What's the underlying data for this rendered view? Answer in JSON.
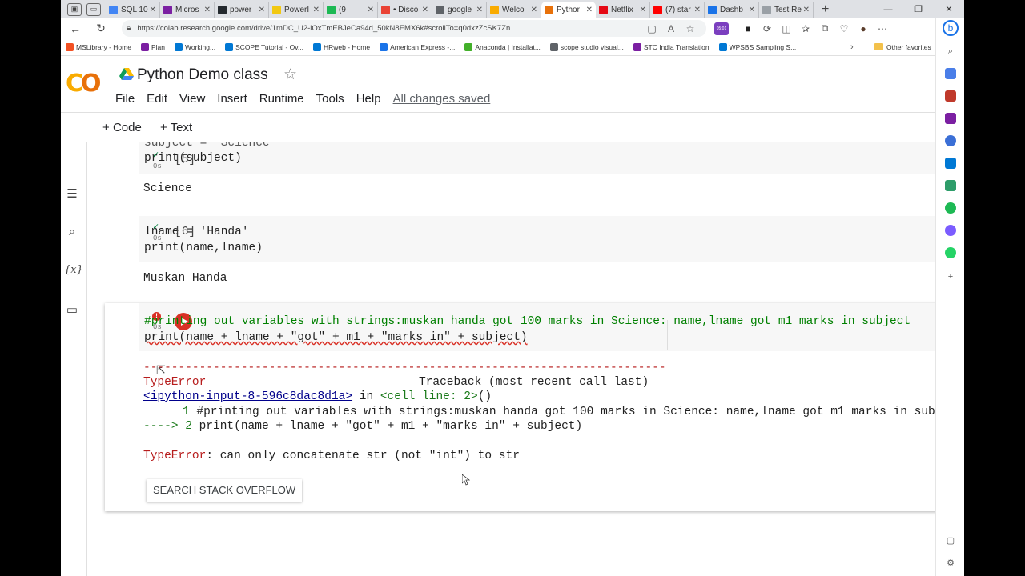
{
  "browser": {
    "tabs": [
      {
        "label": "SQL 10",
        "color": "#4285f4"
      },
      {
        "label": "Micros",
        "color": "#7b1fa2"
      },
      {
        "label": "power",
        "color": "#24292e"
      },
      {
        "label": "PowerI",
        "color": "#f2c811"
      },
      {
        "label": "(9",
        "color": "#1db954"
      },
      {
        "label": "• Disco",
        "color": "#ea4335"
      },
      {
        "label": "google",
        "color": "#5f6368"
      },
      {
        "label": "Welco",
        "color": "#f9ab00"
      },
      {
        "label": "Pythor",
        "color": "#e8710a"
      },
      {
        "label": "Netflix",
        "color": "#e50914"
      },
      {
        "label": "(7) star",
        "color": "#ff0000"
      },
      {
        "label": "Dashb",
        "color": "#1a73e8"
      },
      {
        "label": "Test Re",
        "color": "#9aa0a6"
      }
    ],
    "url": "https://colab.research.google.com/drive/1mDC_U2-lOxTmEBJeCa94d_50kN8EMX6k#scrollTo=q0dxzZcSK7Zn",
    "bookmarks": [
      {
        "label": "MSLibrary - Home",
        "color": "#f25022"
      },
      {
        "label": "Plan",
        "color": "#7b1fa2"
      },
      {
        "label": "Working...",
        "color": "#0078d4"
      },
      {
        "label": "SCOPE Tutorial - Ov...",
        "color": "#0078d4"
      },
      {
        "label": "HRweb - Home",
        "color": "#0078d4"
      },
      {
        "label": "American Express -...",
        "color": "#1a73e8"
      },
      {
        "label": "Anaconda | Installat...",
        "color": "#43b02a"
      },
      {
        "label": "scope studio visual...",
        "color": "#5f6368"
      },
      {
        "label": "STC India Translation",
        "color": "#7b1fa2"
      },
      {
        "label": "WPSBS Sampling S...",
        "color": "#0078d4"
      }
    ],
    "other_favorites": "Other favorites",
    "extension_badge": "05:01"
  },
  "colab": {
    "title": "Python Demo class",
    "menu": [
      "File",
      "Edit",
      "View",
      "Insert",
      "Runtime",
      "Tools",
      "Help"
    ],
    "saved_status": "All changes saved",
    "toolbar": {
      "code": "Code",
      "text": "Text"
    },
    "cells": [
      {
        "number": "[5]",
        "time": "0s",
        "line_partial": "subject = 'Science'",
        "line2": "print(subject)",
        "output": "Science"
      },
      {
        "number": "[6]",
        "time": "0s",
        "line1": "lname = 'Handa'",
        "line2": "print(name,lname)",
        "output": "Muskan Handa"
      },
      {
        "time": "0s",
        "line1": "#printing out variables with strings:muskan handa got 100 marks in Science: name,lname got m1 marks in subject",
        "line2": "print(name + lname + \"got\" + m1 + \"marks in\" + subject)",
        "traceback": {
          "dashes": "---------------------------------------------------------------------------",
          "error_type": "TypeError",
          "traceback_label": "Traceback (most recent call last)",
          "input_link": "<ipython-input-8-596c8dac8d1a>",
          "in_word": "in",
          "cell_line": "<cell line: 2>",
          "paren": "()",
          "tb_line1_num": "1",
          "tb_line1": "#printing out variables with strings:muskan handa got 100 marks in Science: name,lname got m1 marks in subject",
          "arrow": "---->",
          "tb_line2_num": "2",
          "tb_line2": "print(name + lname + \"got\" + m1 + \"marks in\" + subject)",
          "error_message_type": "TypeError",
          "error_message": ": can only concatenate str (not \"int\") to str"
        },
        "stack_overflow_button": "SEARCH STACK OVERFLOW"
      }
    ]
  }
}
